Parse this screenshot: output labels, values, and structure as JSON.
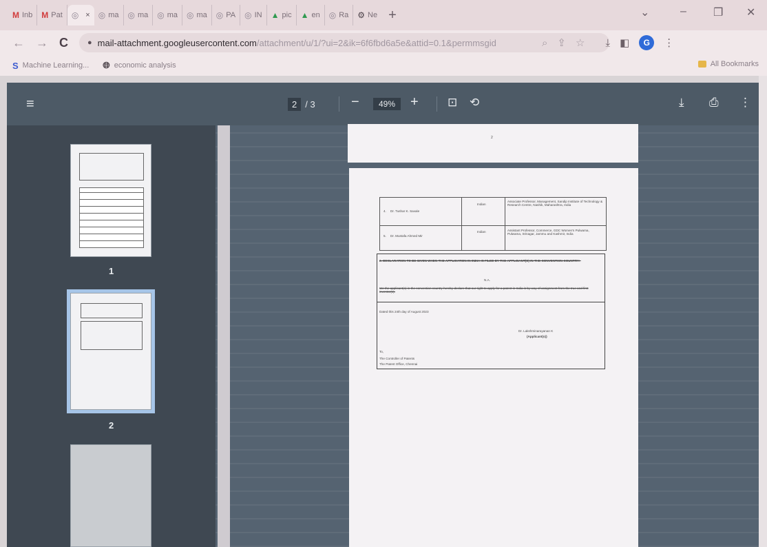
{
  "browser": {
    "tabs": [
      {
        "label": "Inb",
        "icon": "gmail-icon"
      },
      {
        "label": "Pat",
        "icon": "gmail-icon"
      },
      {
        "label": "",
        "icon": "web-icon",
        "active": true,
        "close": "×"
      },
      {
        "label": "ma",
        "icon": "web-icon"
      },
      {
        "label": "ma",
        "icon": "web-icon"
      },
      {
        "label": "ma",
        "icon": "web-icon"
      },
      {
        "label": "ma",
        "icon": "web-icon"
      },
      {
        "label": "PA",
        "icon": "web-icon"
      },
      {
        "label": "IN",
        "icon": "web-icon"
      },
      {
        "label": "pic",
        "icon": "drive-icon"
      },
      {
        "label": "en",
        "icon": "drive-icon"
      },
      {
        "label": "Ra",
        "icon": "web-icon"
      },
      {
        "label": "Ne",
        "icon": "gear-icon"
      }
    ],
    "new_tab": "+",
    "window_controls": {
      "menu": "⌄",
      "minimize": "–",
      "restore": "❐",
      "close": "✕"
    },
    "url_host": "mail-attachment.googleusercontent.com",
    "url_path": "/attachment/u/1/?ui=2&ik=6f6fbd6a5e&attid=0.1&permmsgid",
    "profile_initial": "G",
    "bookmarks": [
      {
        "label": "Machine Learning...",
        "icon": "s-logo-icon"
      },
      {
        "label": "economic analysis",
        "icon": "globe-icon"
      }
    ],
    "all_bookmarks": "All Bookmarks"
  },
  "pdf_viewer": {
    "page_current": "2",
    "page_total": "/ 3",
    "zoom": "49%",
    "thumb_labels": [
      "1",
      "2"
    ],
    "top_page_number": "2"
  },
  "document": {
    "table": [
      {
        "name": "Dr. Tushar K. Savale",
        "nationality": "Indian",
        "address": "Associate Professor, Management, Sandip Institute of Technology & Research Centre, Nashik, Maharashtra, India"
      },
      {
        "name": "Dr. Mustafa Ahmed Mir",
        "nationality": "Indian",
        "address": "Assistant Professor, Commerce, GDC Women's Pulwama, Pulwama, Srinagar, Jammu and Kashmir, India"
      }
    ],
    "declaration_heading": "2. DECLARATION TO BE GIVEN WHEN THE APPLICATION IN INDIA IS FILED BY THE APPLICANT(S) IN THE CONVENTION COUNTRY:-",
    "na": "N.A.",
    "declaration_body": "We the applicant(s) in the convention country hereby declare that our right to apply for a patent in India is by way of assignment from the true and first inventor(s).",
    "dated": "Dated this 24th day of August 2023",
    "signatory": "Dr. Lakshminarayanan K",
    "signatory_role": "(Applicant(s))",
    "to": "To,",
    "addressee_1": "The Controller of Patents",
    "addressee_2": "The Patent Office, Chennai"
  }
}
